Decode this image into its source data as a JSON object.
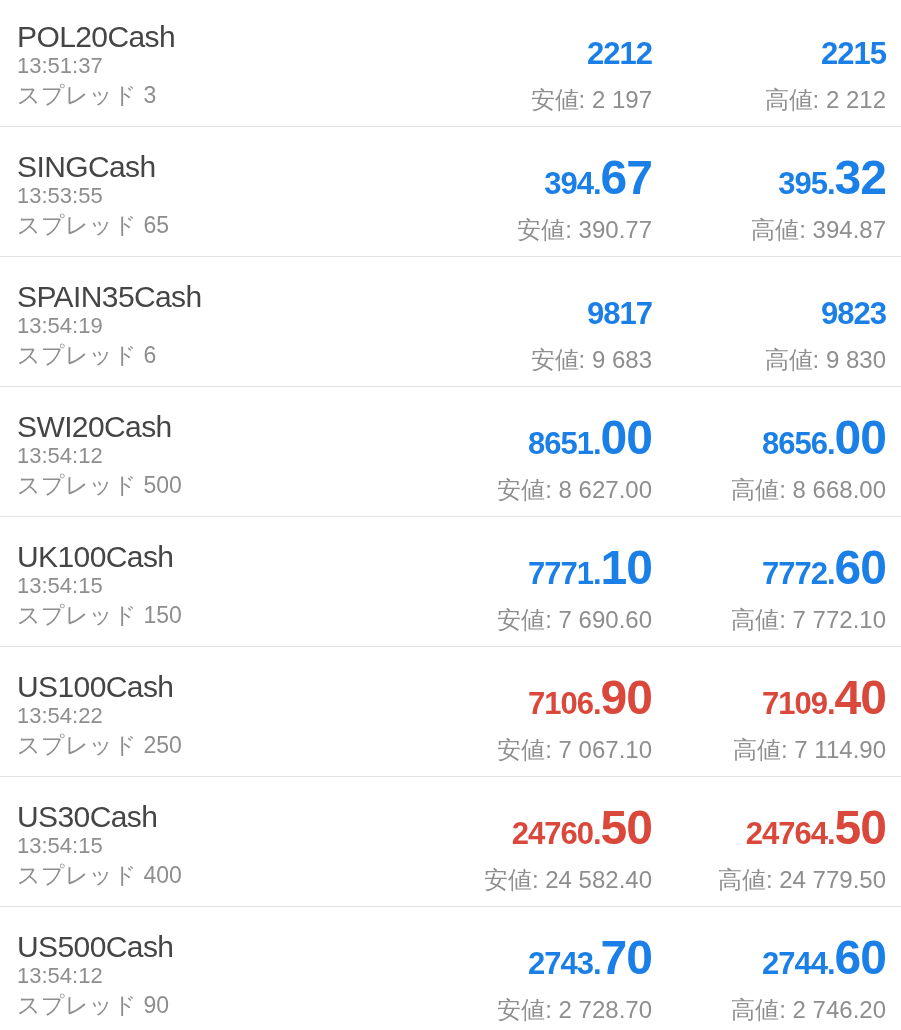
{
  "rows": [
    {
      "symbol": "POL20Cash",
      "time": "13:51:37",
      "spread": "スプレッド 3",
      "color": "#1b7fe8",
      "bid": {
        "digits": "2212"
      },
      "ask": {
        "digits": "2215"
      },
      "low": "安値: 2 197",
      "high": "高値: 2 212"
    },
    {
      "symbol": "SINGCash",
      "time": "13:53:55",
      "spread": "スプレッド 65",
      "color": "#1b7fe8",
      "bid": {
        "digits": "394.",
        "pips": "67"
      },
      "ask": {
        "digits": "395.",
        "pips": "32"
      },
      "low": "安値: 390.77",
      "high": "高値: 394.87"
    },
    {
      "symbol": "SPAIN35Cash",
      "time": "13:54:19",
      "spread": "スプレッド 6",
      "color": "#1b7fe8",
      "bid": {
        "digits": "9817"
      },
      "ask": {
        "digits": "9823"
      },
      "low": "安値: 9 683",
      "high": "高値: 9 830"
    },
    {
      "symbol": "SWI20Cash",
      "time": "13:54:12",
      "spread": "スプレッド 500",
      "color": "#1b7fe8",
      "bid": {
        "digits": "8651.",
        "pips": "00"
      },
      "ask": {
        "digits": "8656.",
        "pips": "00"
      },
      "low": "安値: 8 627.00",
      "high": "高値: 8 668.00"
    },
    {
      "symbol": "UK100Cash",
      "time": "13:54:15",
      "spread": "スプレッド 150",
      "color": "#1b7fe8",
      "bid": {
        "digits": "7771.",
        "pips": "10"
      },
      "ask": {
        "digits": "7772.",
        "pips": "60"
      },
      "low": "安値: 7 690.60",
      "high": "高値: 7 772.10"
    },
    {
      "symbol": "US100Cash",
      "time": "13:54:22",
      "spread": "スプレッド 250",
      "color": "#d9483b",
      "bid": {
        "digits": "7106.",
        "pips": "90"
      },
      "ask": {
        "digits": "7109.",
        "pips": "40"
      },
      "low": "安値: 7 067.10",
      "high": "高値: 7 114.90"
    },
    {
      "symbol": "US30Cash",
      "time": "13:54:15",
      "spread": "スプレッド 400",
      "color": "#d9483b",
      "bid": {
        "digits": "24760.",
        "pips": "50"
      },
      "ask": {
        "digits": "24764.",
        "pips": "50"
      },
      "low": "安値: 24 582.40",
      "high": "高値: 24 779.50"
    },
    {
      "symbol": "US500Cash",
      "time": "13:54:12",
      "spread": "スプレッド 90",
      "color": "#1b7fe8",
      "bid": {
        "digits": "2743.",
        "pips": "70"
      },
      "ask": {
        "digits": "2744.",
        "pips": "60"
      },
      "low": "安値: 2 728.70",
      "high": "高値: 2 746.20"
    }
  ]
}
